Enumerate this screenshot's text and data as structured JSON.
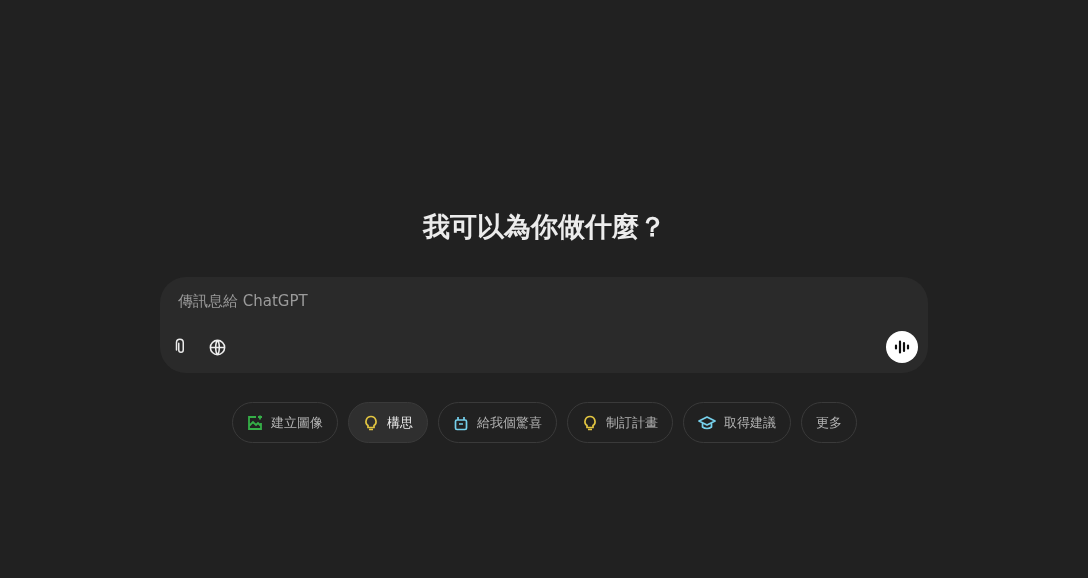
{
  "heading": "我可以為你做什麼？",
  "composer": {
    "placeholder": "傳訊息給 ChatGPT"
  },
  "suggestions": [
    {
      "label": "建立圖像",
      "kind": "image",
      "color": "#35ae47",
      "selected": false
    },
    {
      "label": "構思",
      "kind": "idea",
      "color": "#e2c541",
      "selected": true
    },
    {
      "label": "給我個驚喜",
      "kind": "surprise",
      "color": "#76d0eb",
      "selected": false
    },
    {
      "label": "制訂計畫",
      "kind": "idea",
      "color": "#e2c541",
      "selected": false
    },
    {
      "label": "取得建議",
      "kind": "advice",
      "color": "#76d0eb",
      "selected": false
    },
    {
      "label": "更多",
      "kind": "more",
      "selected": false
    }
  ]
}
